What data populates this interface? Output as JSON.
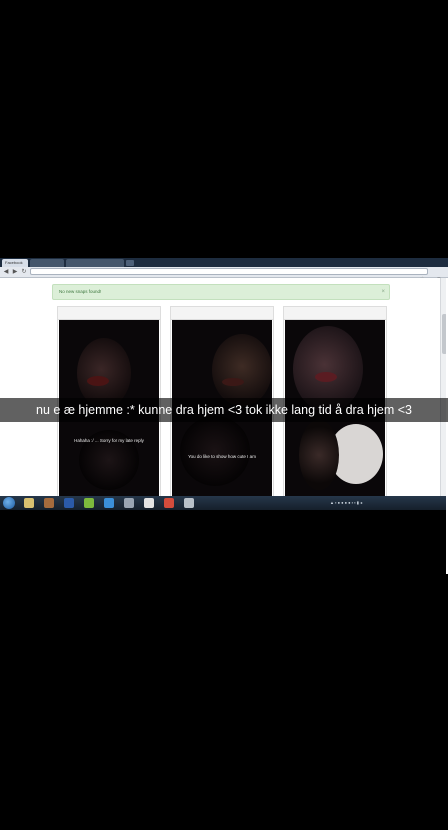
{
  "browser": {
    "tabs": [
      {
        "label": "Facebook"
      },
      {
        "label": ""
      },
      {
        "label": ""
      }
    ],
    "address": ""
  },
  "page": {
    "alert": "No new snaps found!",
    "alert_close": "×",
    "cards": [
      {
        "header": "",
        "caption": "Hahaha :/ ... Sorry for my late reply"
      },
      {
        "header": "",
        "caption": "You do like to show how cute I am"
      },
      {
        "header": "",
        "caption": ""
      }
    ]
  },
  "taskbar": {
    "clock_time": "",
    "clock_date": ""
  },
  "snap_caption": "nu e æ hjemme :* kunne dra hjem <3 tok ikke lang tid å dra hjem <3"
}
